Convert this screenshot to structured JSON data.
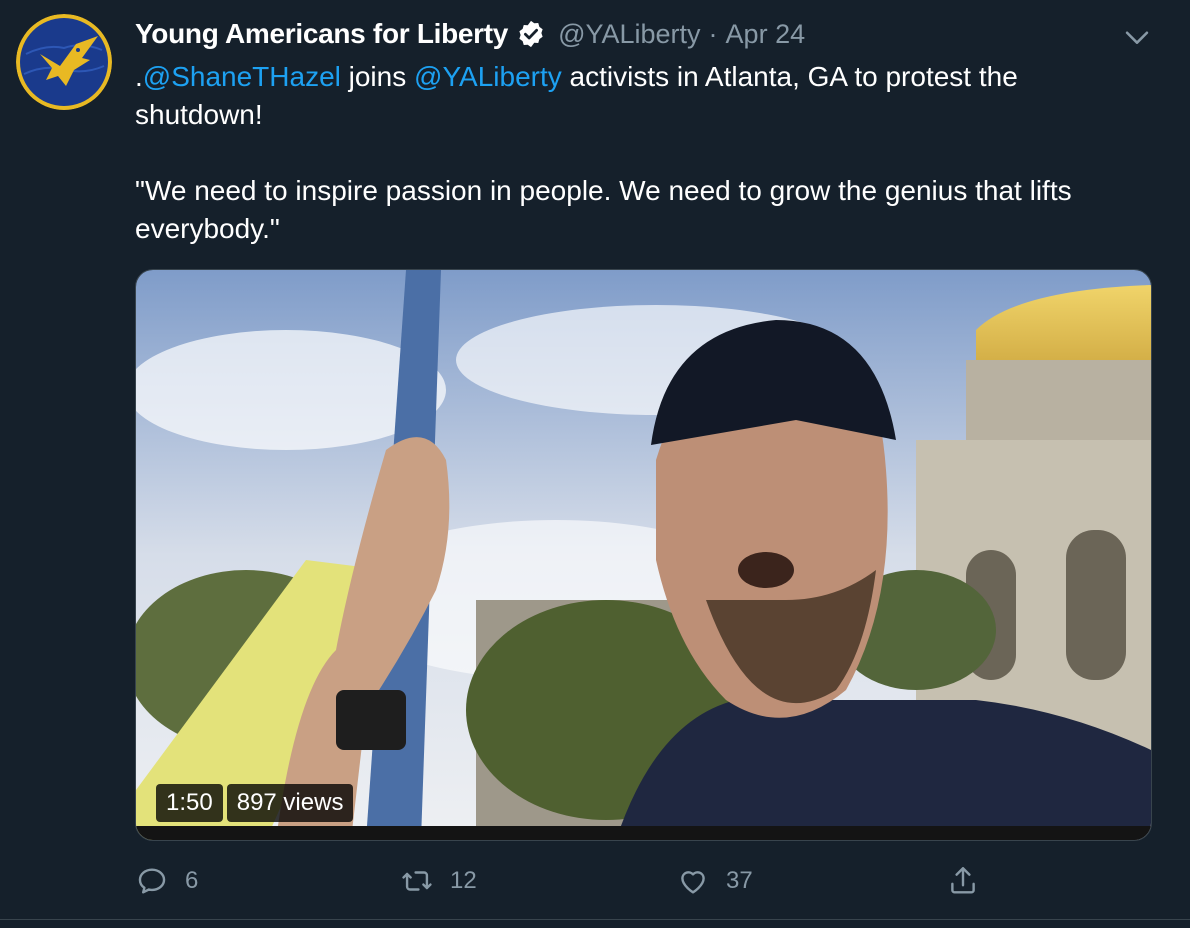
{
  "tweet": {
    "author": {
      "name": "Young Americans for Liberty",
      "handle": "@YALiberty",
      "verified": true,
      "avatar_icon": "eagle-logo-icon"
    },
    "separator": "·",
    "date": "Apr 24",
    "text": {
      "line1_prefix": ".",
      "mention1": "@ShaneTHazel",
      "line1_middle": " joins ",
      "mention2": "@YALiberty",
      "line1_suffix": " activists in Atlanta, GA to protest the shutdown!",
      "quote": "\"We need to inspire passion in people. We need to grow the genius that lifts everybody.\""
    },
    "video": {
      "duration": "1:50",
      "views": "897 views"
    },
    "actions": {
      "replies": "6",
      "retweets": "12",
      "likes": "37"
    }
  },
  "colors": {
    "background": "#15202b",
    "text": "#ffffff",
    "secondary": "#8899a6",
    "accent": "#1da1f2",
    "border": "#38444d"
  }
}
